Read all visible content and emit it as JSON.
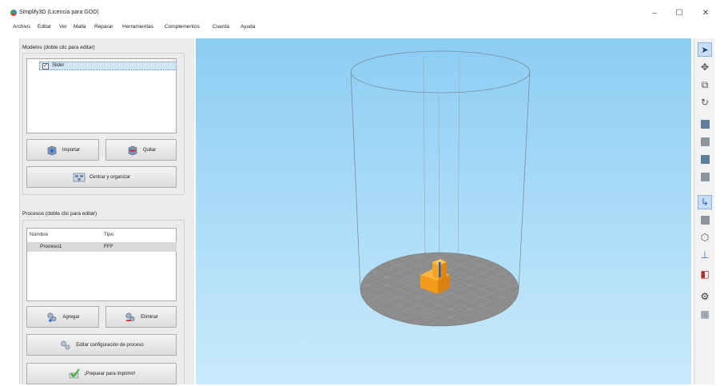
{
  "window": {
    "title": "Simplify3D (Licencia para GOD)",
    "minimize_glyph": "–",
    "maximize_glyph": "☐",
    "close_glyph": "✕"
  },
  "menu": [
    "Archivo",
    "Editar",
    "Ver",
    "Malla",
    "Reparar",
    "Herramientas",
    "Complementos",
    "Cuenta",
    "Ayuda"
  ],
  "models": {
    "label": "Modelos (doble clic para editar)",
    "items": [
      {
        "name": "Slider",
        "checked": true
      }
    ],
    "import_label": "Importar",
    "remove_label": "Quitar",
    "center_label": "Centrar y organizar"
  },
  "processes": {
    "label": "Procesos (doble clic para editar)",
    "columns": [
      "Nombre",
      "Tipo"
    ],
    "rows": [
      {
        "name": "Proceso1",
        "type": "FFF"
      }
    ],
    "add_label": "Agregar",
    "delete_label": "Eliminar",
    "edit_label": "Editar configuración de proceso",
    "prepare_label": "¡Preparar para imprimir!"
  },
  "toolbar": {
    "tools": [
      {
        "icon": "cursor-arrow-icon",
        "glyph": "➤",
        "active": true
      },
      {
        "icon": "move-cross-icon",
        "glyph": "✥",
        "active": false
      },
      {
        "icon": "pan-view-icon",
        "glyph": "⧉",
        "active": false
      },
      {
        "icon": "rotate-view-icon",
        "glyph": "↻",
        "active": false
      },
      {
        "icon": "view-top-cube-icon",
        "glyph": "",
        "active": false
      },
      {
        "icon": "view-front-cube-icon",
        "glyph": "",
        "active": false
      },
      {
        "icon": "view-side-cube-icon",
        "glyph": "",
        "active": false
      },
      {
        "icon": "view-iso-cube-icon",
        "glyph": "",
        "active": false
      },
      {
        "icon": "axes-icon",
        "glyph": "↳",
        "active": true
      },
      {
        "icon": "solid-view-cube-icon",
        "glyph": "",
        "active": false
      },
      {
        "icon": "wireframe-cube-icon",
        "glyph": "⬡",
        "active": false
      },
      {
        "icon": "support-arrow-icon",
        "glyph": "⊥",
        "active": false
      },
      {
        "icon": "cross-section-icon",
        "glyph": "◧",
        "active": false
      },
      {
        "icon": "settings-gear-icon",
        "glyph": "⚙",
        "active": false
      },
      {
        "icon": "mesh-grid-icon",
        "glyph": "▦",
        "active": false
      }
    ]
  },
  "colors": {
    "viewport_top": "#8ccdf3",
    "viewport_bottom": "#c9eafc",
    "bed": "#8c8c8c",
    "model": "#f7a320",
    "active_tool": "#c7def5"
  }
}
